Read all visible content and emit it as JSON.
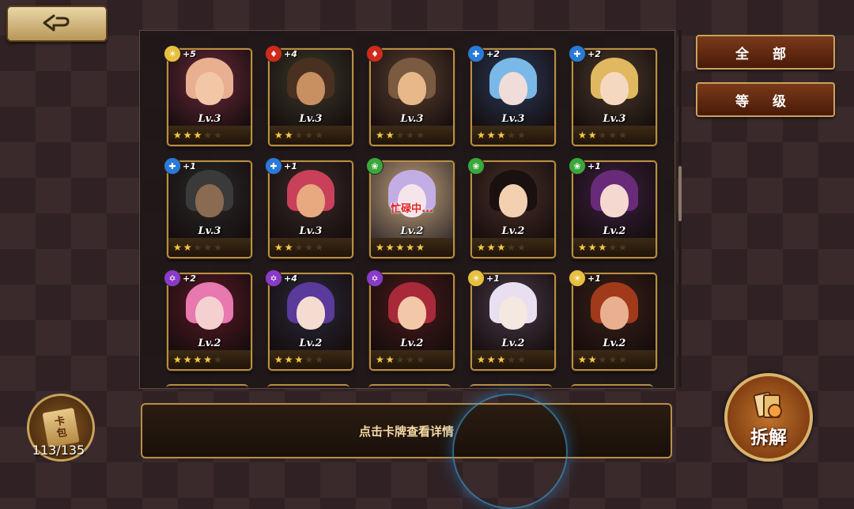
{
  "header": {
    "back_icon": "back-arrow-icon"
  },
  "sort_buttons": {
    "all_label": "全 部",
    "level_label": "等 级"
  },
  "info_bar": {
    "text": "点击卡牌查看详情"
  },
  "card_pack": {
    "icon_text_top": "卡",
    "icon_text_bottom": "包",
    "count": "113/135"
  },
  "disband_button": {
    "label": "拆解"
  },
  "colors": {
    "gold_border": "#b98e45",
    "star_on": "#f4c84a",
    "busy_text": "#e02020"
  },
  "cards": [
    {
      "element": "light",
      "plus": "+5",
      "level": "Lv.3",
      "stars": 3,
      "bg": "#6a2a3a",
      "skin": "#f2c7a8",
      "hair": "#e8b090"
    },
    {
      "element": "fire",
      "plus": "+4",
      "level": "Lv.3",
      "stars": 2,
      "bg": "#3a3a2a",
      "skin": "#c89060",
      "hair": "#4a3020"
    },
    {
      "element": "fire",
      "plus": "",
      "level": "Lv.3",
      "stars": 2,
      "bg": "#5a4030",
      "skin": "#e8b88a",
      "hair": "#7a5a40"
    },
    {
      "element": "water",
      "plus": "+2",
      "level": "Lv.3",
      "stars": 3,
      "bg": "#2a3a5a",
      "skin": "#f0dcd8",
      "hair": "#7ab8e8"
    },
    {
      "element": "water",
      "plus": "+2",
      "level": "Lv.3",
      "stars": 2,
      "bg": "#4a3a2a",
      "skin": "#f5d8c0",
      "hair": "#e0b860"
    },
    {
      "element": "water",
      "plus": "+1",
      "level": "Lv.3",
      "stars": 2,
      "bg": "#2a2a2a",
      "skin": "#8a6a50",
      "hair": "#3a3a3a"
    },
    {
      "element": "water",
      "plus": "+1",
      "level": "Lv.3",
      "stars": 2,
      "bg": "#3a2a2a",
      "skin": "#e8a880",
      "hair": "#c8405a"
    },
    {
      "element": "wind",
      "plus": "",
      "level": "Lv.2",
      "stars": 5,
      "bg": "#b89060",
      "skin": "#f5e0e8",
      "hair": "#b8a0e0",
      "busy": "忙碌中..."
    },
    {
      "element": "wind",
      "plus": "",
      "level": "Lv.2",
      "stars": 3,
      "bg": "#4a3028",
      "skin": "#f2d0b0",
      "hair": "#1a1010"
    },
    {
      "element": "wind",
      "plus": "+1",
      "level": "Lv.2",
      "stars": 3,
      "bg": "#3a2040",
      "skin": "#f5d8d0",
      "hair": "#6a2a7a"
    },
    {
      "element": "dark",
      "plus": "+2",
      "level": "Lv.2",
      "stars": 4,
      "bg": "#5a1a28",
      "skin": "#f5d0d0",
      "hair": "#e878b0"
    },
    {
      "element": "dark",
      "plus": "+4",
      "level": "Lv.2",
      "stars": 3,
      "bg": "#2a2a3a",
      "skin": "#f5dcd0",
      "hair": "#5a3a9a"
    },
    {
      "element": "dark",
      "plus": "",
      "level": "Lv.2",
      "stars": 2,
      "bg": "#4a1a1a",
      "skin": "#f2c8a8",
      "hair": "#a82a3a"
    },
    {
      "element": "light",
      "plus": "+1",
      "level": "Lv.2",
      "stars": 3,
      "bg": "#4a3a4a",
      "skin": "#f5e8e0",
      "hair": "#e8e0f0"
    },
    {
      "element": "light",
      "plus": "+1",
      "level": "Lv.2",
      "stars": 2,
      "bg": "#3a2018",
      "skin": "#e8b090",
      "hair": "#a03a1a"
    }
  ]
}
